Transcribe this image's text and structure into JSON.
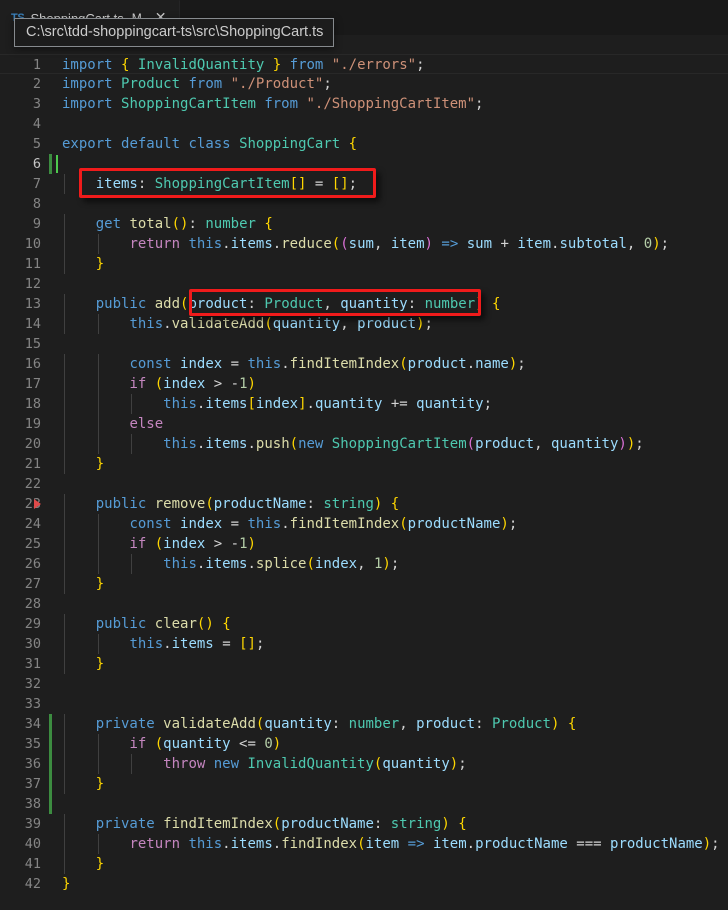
{
  "tab": {
    "file_icon": "TS",
    "label": "ShoppingCart.ts",
    "dirty_indicator": "M",
    "close_icon": "✕"
  },
  "tooltip": {
    "path": "C:\\src\\tdd-shoppingcart-ts\\src\\ShoppingCart.ts"
  },
  "editor": {
    "language": "typescript",
    "theme": "Dark+",
    "cursor_line": 6,
    "total_lines": 42,
    "lines": [
      {
        "n": "1",
        "text": "import { InvalidQuantity } from \"./errors\";"
      },
      {
        "n": "2",
        "text": "import Product from \"./Product\";"
      },
      {
        "n": "3",
        "text": "import ShoppingCartItem from \"./ShoppingCartItem\";"
      },
      {
        "n": "4",
        "text": ""
      },
      {
        "n": "5",
        "text": "export default class ShoppingCart {"
      },
      {
        "n": "6",
        "text": ""
      },
      {
        "n": "7",
        "text": "    items: ShoppingCartItem[] = [];"
      },
      {
        "n": "8",
        "text": ""
      },
      {
        "n": "9",
        "text": "    get total(): number {"
      },
      {
        "n": "10",
        "text": "        return this.items.reduce((sum, item) => sum + item.subtotal, 0);"
      },
      {
        "n": "11",
        "text": "    }"
      },
      {
        "n": "12",
        "text": ""
      },
      {
        "n": "13",
        "text": "    public add(product: Product, quantity: number) {"
      },
      {
        "n": "14",
        "text": "        this.validateAdd(quantity, product);"
      },
      {
        "n": "15",
        "text": ""
      },
      {
        "n": "16",
        "text": "        const index = this.findItemIndex(product.name);"
      },
      {
        "n": "17",
        "text": "        if (index > -1)"
      },
      {
        "n": "18",
        "text": "            this.items[index].quantity += quantity;"
      },
      {
        "n": "19",
        "text": "        else"
      },
      {
        "n": "20",
        "text": "            this.items.push(new ShoppingCartItem(product, quantity));"
      },
      {
        "n": "21",
        "text": "    }"
      },
      {
        "n": "22",
        "text": ""
      },
      {
        "n": "23",
        "text": "    public remove(productName: string) {"
      },
      {
        "n": "24",
        "text": "        const index = this.findItemIndex(productName);"
      },
      {
        "n": "25",
        "text": "        if (index > -1)"
      },
      {
        "n": "26",
        "text": "            this.items.splice(index, 1);"
      },
      {
        "n": "27",
        "text": "    }"
      },
      {
        "n": "28",
        "text": ""
      },
      {
        "n": "29",
        "text": "    public clear() {"
      },
      {
        "n": "30",
        "text": "        this.items = [];"
      },
      {
        "n": "31",
        "text": "    }"
      },
      {
        "n": "32",
        "text": ""
      },
      {
        "n": "33",
        "text": ""
      },
      {
        "n": "34",
        "text": "    private validateAdd(quantity: number, product: Product) {"
      },
      {
        "n": "35",
        "text": "        if (quantity <= 0)"
      },
      {
        "n": "36",
        "text": "            throw new InvalidQuantity(quantity);"
      },
      {
        "n": "37",
        "text": "    }"
      },
      {
        "n": "38",
        "text": ""
      },
      {
        "n": "39",
        "text": "    private findItemIndex(productName: string) {"
      },
      {
        "n": "40",
        "text": "        return this.items.findIndex(item => item.productName === productName);"
      },
      {
        "n": "41",
        "text": "    }"
      },
      {
        "n": "42",
        "text": "}"
      }
    ],
    "git_added_lines": [
      6,
      34,
      35,
      36,
      37,
      38
    ],
    "breakpoint_marker_line": 23
  },
  "annotations": [
    {
      "name": "items-property-highlight",
      "target_line": 7,
      "label": "items: ShoppingCartItem[] = [];"
    },
    {
      "name": "add-parameters-highlight",
      "target_line": 13,
      "label": "(product: Product, quantity: number)"
    }
  ],
  "colors": {
    "editor_background": "#1e1e1e",
    "tabbar_background": "#191919",
    "annotation_red": "#f01b1b",
    "git_added_green": "#3c8c40",
    "cursor_green": "#4ec94e",
    "line_number": "#858585",
    "keyword_blue": "#569cd6",
    "control_purple": "#c586c0",
    "type_teal": "#4ec9b0",
    "string_orange": "#ce9178",
    "function_yellow": "#dcdcaa",
    "variable_lightblue": "#9cdcfe",
    "number_green": "#b5cea8"
  }
}
